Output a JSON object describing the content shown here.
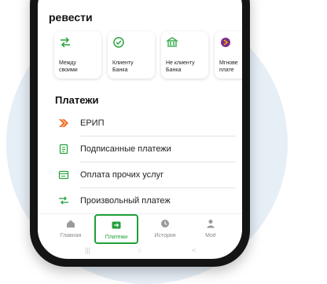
{
  "transfers": {
    "title": "ревести",
    "cards": [
      {
        "label": "Между\nсвоими",
        "icon": "arrows-exchange-icon"
      },
      {
        "label": "Клиенту\nБанка",
        "icon": "check-circle-icon"
      },
      {
        "label": "Не клиенту\nБанка",
        "icon": "bank-icon"
      },
      {
        "label": "Мгнове\nплате",
        "icon": "instant-payment-icon"
      }
    ]
  },
  "payments": {
    "title": "Платежи",
    "items": [
      {
        "label": "ЕРИП",
        "icon": "erip-icon"
      },
      {
        "label": "Подписанные платежи",
        "icon": "document-icon"
      },
      {
        "label": "Оплата прочих услуг",
        "icon": "bill-icon"
      },
      {
        "label": "Произвольный платеж",
        "icon": "arrows-transfer-icon"
      }
    ]
  },
  "nav": {
    "items": [
      {
        "label": "Главная",
        "icon": "home-icon"
      },
      {
        "label": "Платежи",
        "icon": "payments-icon",
        "active": true
      },
      {
        "label": "История",
        "icon": "clock-icon"
      },
      {
        "label": "Моё",
        "icon": "user-icon"
      }
    ]
  },
  "system_nav": {
    "recent": "|||",
    "home": "○",
    "back": "<"
  },
  "colors": {
    "accent": "#21a038",
    "erip": "#f26b21",
    "background_circle": "#e6eef6"
  }
}
